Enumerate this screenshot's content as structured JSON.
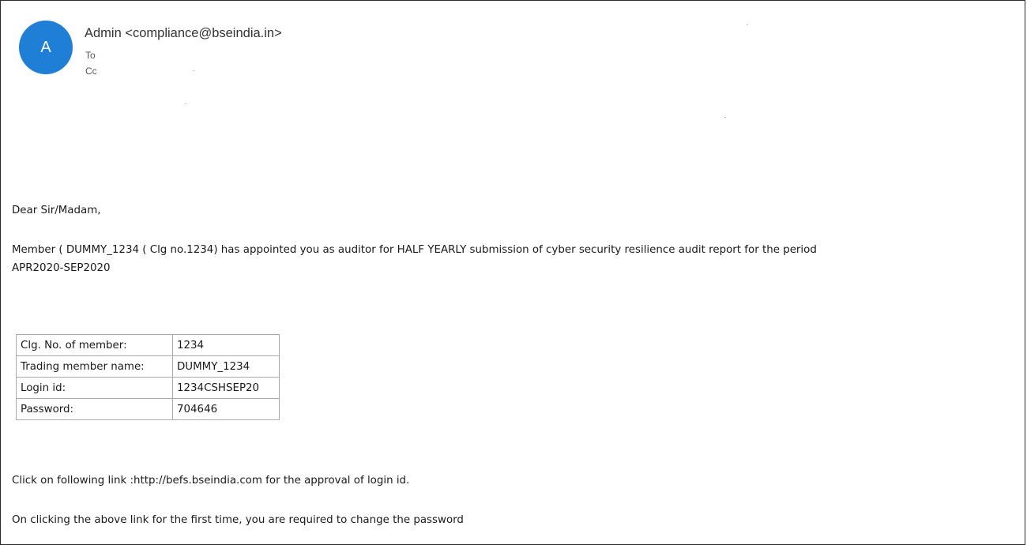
{
  "header": {
    "avatar_initial": "A",
    "sender": "Admin <compliance@bseindia.in>",
    "to_label": "To",
    "cc_label": "Cc",
    "avatar_color": "#1f7fd6"
  },
  "body": {
    "greeting": "Dear Sir/Madam,",
    "paragraph_line1": "Member ( DUMMY_1234 ( Clg no.1234) has appointed you as auditor for HALF YEARLY submission of cyber security resilience audit report for the period",
    "paragraph_line2": "APR2020-SEP2020",
    "details": [
      {
        "label": "Clg. No. of member:",
        "value": "1234"
      },
      {
        "label": "Trading member name:",
        "value": "DUMMY_1234"
      },
      {
        "label": "Login id:",
        "value": "1234CSHSEP20"
      },
      {
        "label": "Password:",
        "value": "704646"
      }
    ],
    "link_line": "Click on following link :http://befs.bseindia.com for the approval of login id.",
    "note_line": "On clicking the above link for the first time, you are required to change the password"
  }
}
